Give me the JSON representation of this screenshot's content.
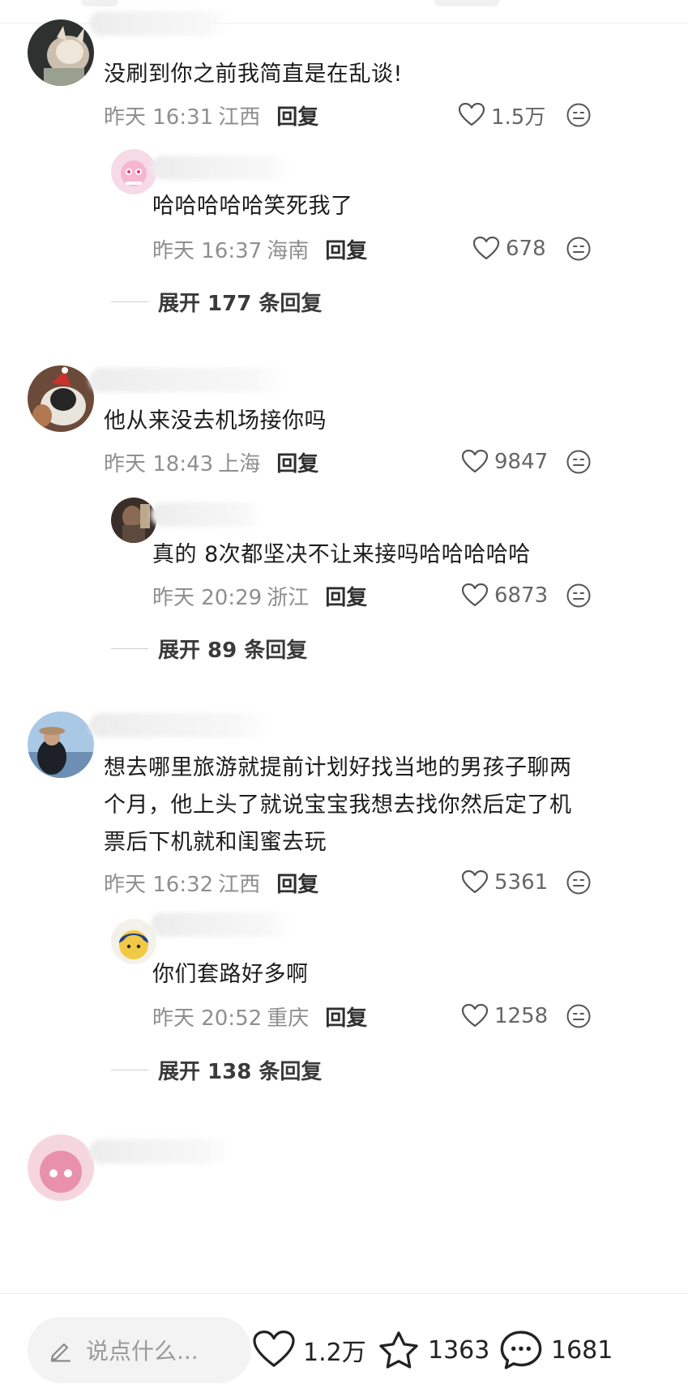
{
  "comments": [
    {
      "text": "没刷到你之前我简直是在乱谈!",
      "time": "昨天 16:31",
      "location": "江西",
      "reply_label": "回复",
      "likes": "1.5万",
      "reply": {
        "text": "哈哈哈哈哈笑死我了",
        "time": "昨天 16:37",
        "location": "海南",
        "reply_label": "回复",
        "likes": "678"
      },
      "expand": "展开 177 条回复"
    },
    {
      "text": "他从来没去机场接你吗",
      "time": "昨天 18:43",
      "location": "上海",
      "reply_label": "回复",
      "likes": "9847",
      "reply": {
        "text": "真的 8次都坚决不让来接吗哈哈哈哈哈",
        "time": "昨天 20:29",
        "location": "浙江",
        "reply_label": "回复",
        "likes": "6873"
      },
      "expand": "展开 89 条回复"
    },
    {
      "text_lines": [
        "想去哪里旅游就提前计划好找当地的男孩子聊两",
        "个月，他上头了就说宝宝我想去找你然后定了机",
        "票后下机就和闺蜜去玩"
      ],
      "time": "昨天 16:32",
      "location": "江西",
      "reply_label": "回复",
      "likes": "5361",
      "reply": {
        "text": "你们套路好多啊",
        "time": "昨天 20:52",
        "location": "重庆",
        "reply_label": "回复",
        "likes": "1258"
      },
      "expand": "展开 138 条回复"
    }
  ],
  "bottom_bar": {
    "input_placeholder": "说点什么...",
    "likes": "1.2万",
    "stars": "1363",
    "comments": "1681"
  },
  "icons": {
    "heart": "heart-icon",
    "emoji": "emoji-face-icon",
    "pencil": "pencil-icon",
    "star": "star-icon",
    "chat": "chat-bubble-icon"
  },
  "colors": {
    "meta_gray": "#8f8f8f",
    "text": "#1c1c1c",
    "bar_bg": "#f3f3f3"
  }
}
